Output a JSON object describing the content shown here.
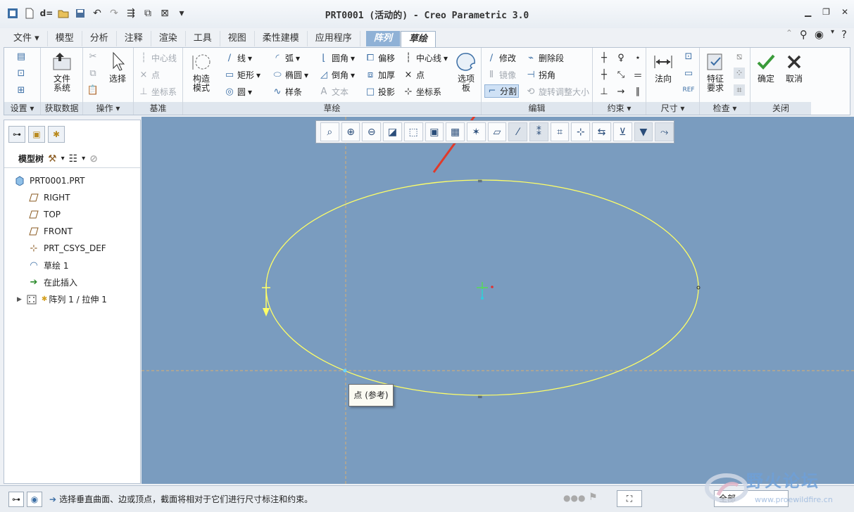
{
  "window": {
    "title": "PRT0001 (活动的) - Creo Parametric 3.0"
  },
  "tabs": [
    {
      "label": "文件",
      "active": false
    },
    {
      "label": "模型",
      "active": false
    },
    {
      "label": "分析",
      "active": false
    },
    {
      "label": "注释",
      "active": false
    },
    {
      "label": "渲染",
      "active": false
    },
    {
      "label": "工具",
      "active": false
    },
    {
      "label": "视图",
      "active": false
    },
    {
      "label": "柔性建模",
      "active": false
    },
    {
      "label": "应用程序",
      "active": false
    },
    {
      "label": "阵列",
      "active": false
    },
    {
      "label": "草绘",
      "active": true
    }
  ],
  "ribbon": {
    "setup": {
      "footer": "设置"
    },
    "get_data": {
      "file_system": "文件\n系统",
      "footer": "获取数据"
    },
    "operations": {
      "select": "选择",
      "footer": "操作"
    },
    "datum": {
      "centerline": "中心线",
      "point": "点",
      "csys": "坐标系",
      "footer": "基准"
    },
    "sketch": {
      "construction": "构造\n模式",
      "line": "线",
      "arc": "弧",
      "fillet": "圆角",
      "offset": "偏移",
      "centerline": "中心线",
      "rectangle": "矩形",
      "ellipse": "椭圆",
      "chamfer": "倒角",
      "thicken": "加厚",
      "point": "点",
      "circle": "圆",
      "spline": "样条",
      "text": "文本",
      "project": "投影",
      "csys": "坐标系",
      "palette": "选项\n板",
      "footer": "草绘"
    },
    "edit": {
      "modify": "修改",
      "delete_segment": "删除段",
      "mirror": "镜像",
      "corner": "拐角",
      "divide": "分割",
      "rotate_resize": "旋转调整大小",
      "footer": "编辑"
    },
    "constrain": {
      "footer": "约束"
    },
    "dimension": {
      "normal": "法向",
      "footer": "尺寸"
    },
    "inspect": {
      "feature_req": "特征\n要求",
      "footer": "检查"
    },
    "close": {
      "ok": "确定",
      "cancel": "取消",
      "footer": "关闭"
    }
  },
  "model_tree": {
    "header": "模型树",
    "items": [
      {
        "label": "PRT0001.PRT",
        "icon": "part-icon"
      },
      {
        "label": "RIGHT",
        "icon": "datum-plane-icon"
      },
      {
        "label": "TOP",
        "icon": "datum-plane-icon"
      },
      {
        "label": "FRONT",
        "icon": "datum-plane-icon"
      },
      {
        "label": "PRT_CSYS_DEF",
        "icon": "csys-icon"
      },
      {
        "label": "草绘 1",
        "icon": "sketch-icon"
      },
      {
        "label": "在此插入",
        "icon": "insert-arrow-icon"
      },
      {
        "label": "阵列 1 / 拉伸 1",
        "icon": "pattern-icon"
      }
    ]
  },
  "graphics": {
    "tooltip": "点 (参考)"
  },
  "status": {
    "message": "选择垂直曲面、边或顶点，截面将相对于它们进行尺寸标注和约束。",
    "filter": "全部"
  },
  "watermark": {
    "name": "野火论坛",
    "url": "www.proewildfire.cn"
  },
  "colors": {
    "canvas": "#7a9cbf",
    "sketch": "#ffff66",
    "accent": "#8fb1d6"
  }
}
